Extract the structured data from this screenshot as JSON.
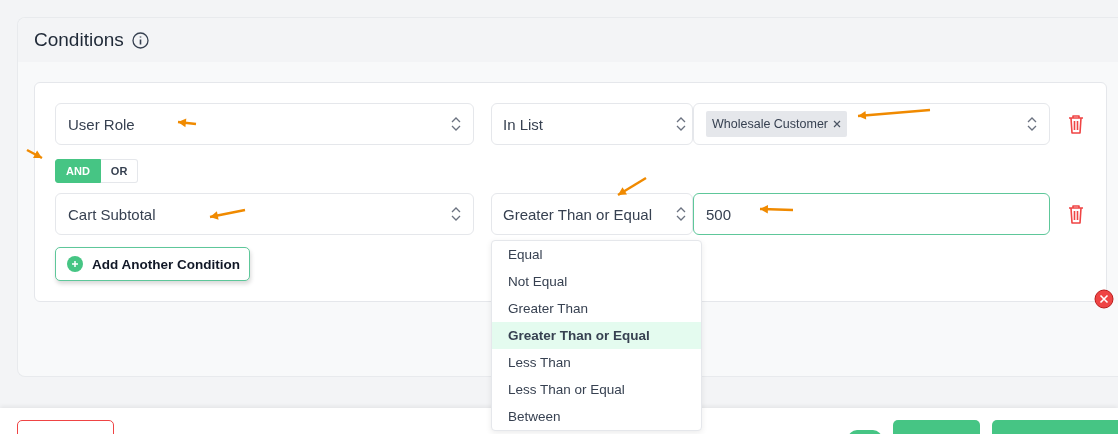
{
  "section": {
    "title": "Conditions"
  },
  "conditions": [
    {
      "field": "User Role",
      "operator": "In List",
      "value": {
        "kind": "tags",
        "focused": false,
        "tags": [
          "Wholesale Customer"
        ]
      }
    },
    {
      "field": "Cart Subtotal",
      "operator": "Greater Than or Equal",
      "value": {
        "kind": "text",
        "focused": true,
        "text": "500"
      },
      "operator_menu": [
        {
          "label": "Equal",
          "selected": false
        },
        {
          "label": "Not Equal",
          "selected": false
        },
        {
          "label": "Greater Than",
          "selected": false
        },
        {
          "label": "Greater Than or Equal",
          "selected": true
        },
        {
          "label": "Less Than",
          "selected": false
        },
        {
          "label": "Less Than or Equal",
          "selected": false
        },
        {
          "label": "Between",
          "selected": false
        }
      ]
    }
  ],
  "connector": [
    {
      "label": "AND",
      "selected": true
    },
    {
      "label": "OR",
      "selected": false
    }
  ],
  "add_button": "Add Another Condition",
  "footer": {
    "toggle": {
      "on": true
    }
  }
}
